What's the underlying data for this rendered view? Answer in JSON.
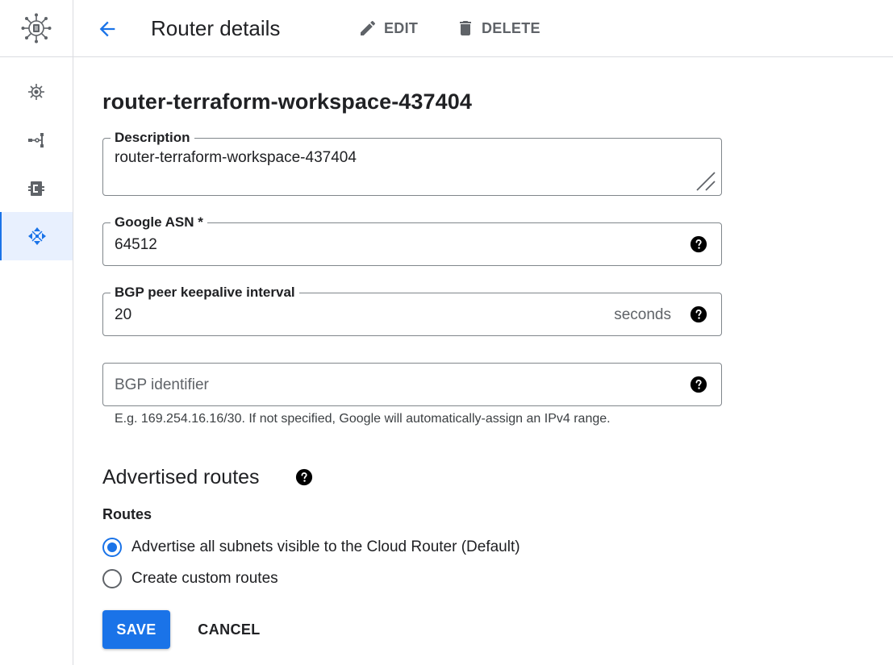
{
  "app": {
    "logo_icon": "router-hub-icon"
  },
  "rail": {
    "items": [
      {
        "icon": "router-icon",
        "active": false
      },
      {
        "icon": "topology-icon",
        "active": false
      },
      {
        "icon": "server-icon",
        "active": false
      },
      {
        "icon": "network-arrows-icon",
        "active": true
      }
    ]
  },
  "header": {
    "title": "Router details",
    "edit_label": "EDIT",
    "delete_label": "DELETE"
  },
  "router": {
    "name": "router-terraform-workspace-437404"
  },
  "form": {
    "description": {
      "label": "Description",
      "value": "router-terraform-workspace-437404"
    },
    "asn": {
      "label": "Google ASN *",
      "value": "64512"
    },
    "keepalive": {
      "label": "BGP peer keepalive interval",
      "value": "20",
      "suffix": "seconds"
    },
    "bgp_identifier": {
      "placeholder": "BGP identifier",
      "hint": "E.g. 169.254.16.16/30. If not specified, Google will automatically-assign an IPv4 range."
    }
  },
  "advertised_routes": {
    "title": "Advertised routes",
    "routes_label": "Routes",
    "options": [
      {
        "label": "Advertise all subnets visible to the Cloud Router (Default)",
        "checked": true
      },
      {
        "label": "Create custom routes",
        "checked": false
      }
    ]
  },
  "actions": {
    "save_label": "SAVE",
    "cancel_label": "CANCEL"
  },
  "colors": {
    "accent": "#1a73e8",
    "text": "#202124",
    "muted": "#5f6368",
    "border": "#80868b"
  }
}
